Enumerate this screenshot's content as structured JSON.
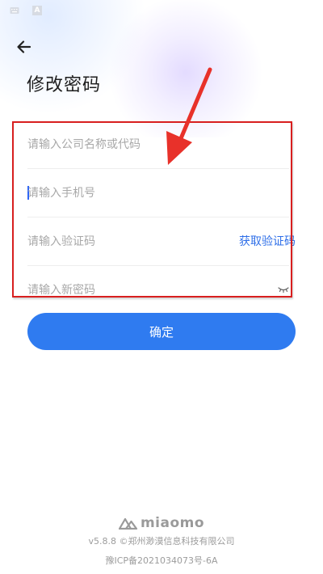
{
  "status_bar": {
    "icons": [
      "keyboard-icon",
      "a-icon"
    ]
  },
  "header": {
    "back_icon": "arrow-left",
    "title": "修改密码"
  },
  "form": {
    "company_placeholder": "请输入公司名称或代码",
    "phone_placeholder": "请输入手机号",
    "code_placeholder": "请输入验证码",
    "get_code_label": "获取验证码",
    "password_placeholder": "请输入新密码"
  },
  "submit_label": "确定",
  "footer": {
    "brand": "miaomo",
    "version": "v5.8.8 ©郑州渺漠信息科技有限公司",
    "icp": "豫ICP备2021034073号-6A"
  },
  "colors": {
    "primary": "#2f7bf0",
    "link": "#2f6fe8",
    "annotation_red": "#d81f1f"
  }
}
